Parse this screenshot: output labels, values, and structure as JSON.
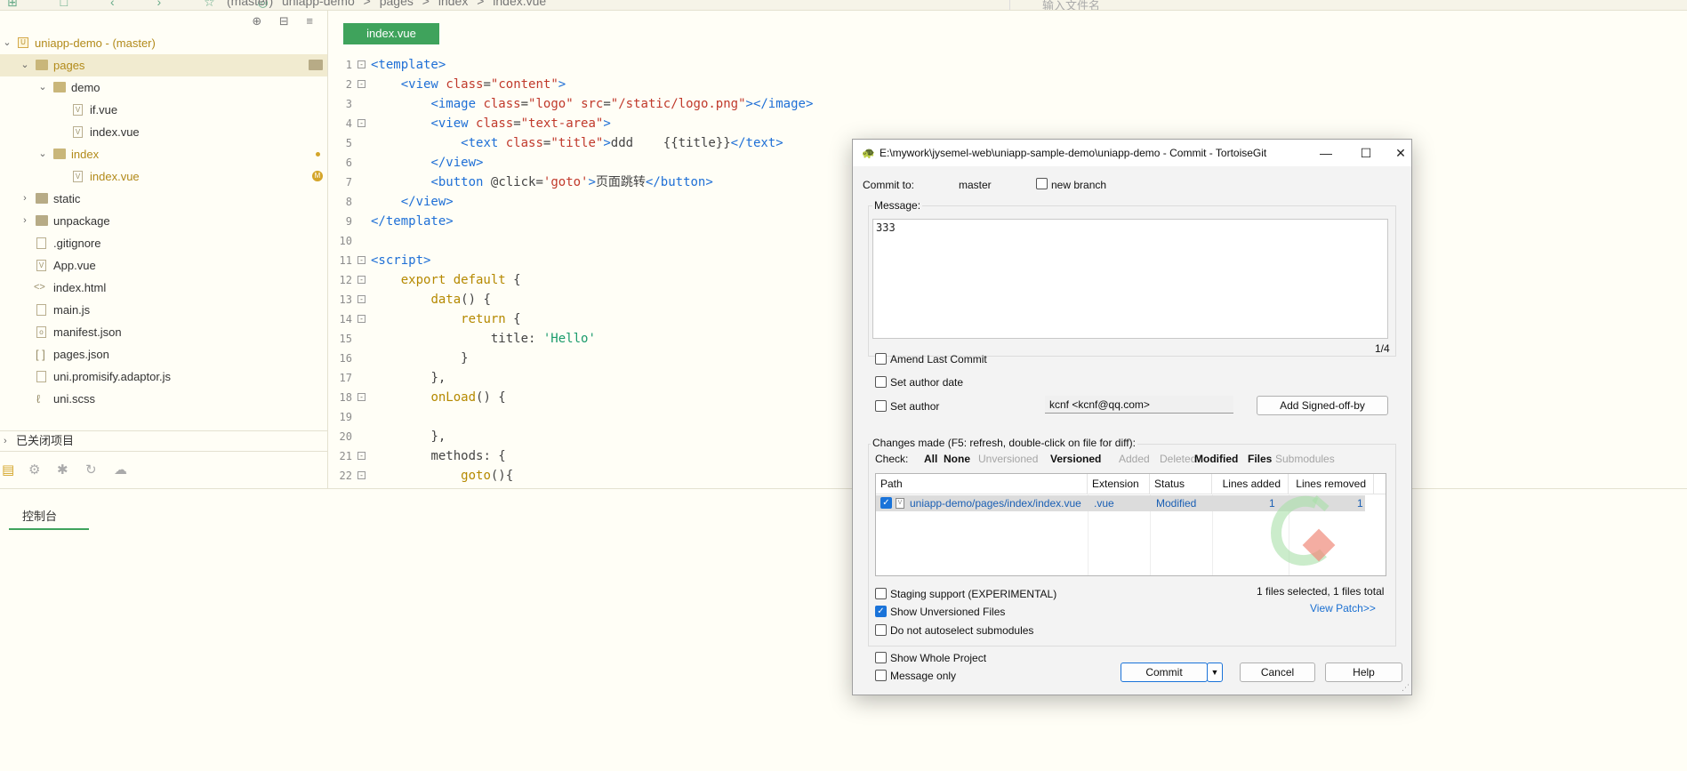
{
  "topbar": {
    "breadcrumbs": [
      "(master)",
      "uniapp-demo",
      ">",
      "pages",
      ">",
      "index",
      ">",
      "index.vue"
    ],
    "search_placeholder": "输入文件名"
  },
  "sidebar": {
    "tree": [
      {
        "label": "uniapp-demo - (master)",
        "kind": "project",
        "arrow": "v"
      },
      {
        "label": "pages",
        "kind": "folder-open",
        "arrow": "v"
      },
      {
        "label": "demo",
        "kind": "folder-open",
        "arrow": "v"
      },
      {
        "label": "if.vue",
        "kind": "file"
      },
      {
        "label": "index.vue",
        "kind": "file"
      },
      {
        "label": "index",
        "kind": "folder-open",
        "arrow": "v"
      },
      {
        "label": "index.vue",
        "kind": "file"
      },
      {
        "label": "static",
        "kind": "folder",
        "arrow": ">"
      },
      {
        "label": "unpackage",
        "kind": "folder",
        "arrow": ">"
      },
      {
        "label": ".gitignore",
        "kind": "file"
      },
      {
        "label": "App.vue",
        "kind": "file"
      },
      {
        "label": "index.html",
        "kind": "file"
      },
      {
        "label": "main.js",
        "kind": "file"
      },
      {
        "label": "manifest.json",
        "kind": "file"
      },
      {
        "label": "pages.json",
        "kind": "file"
      },
      {
        "label": "uni.promisify.adaptor.js",
        "kind": "file"
      },
      {
        "label": "uni.scss",
        "kind": "file"
      }
    ],
    "modified_badge": "M",
    "closed_projects": "已关闭项目"
  },
  "editor": {
    "tab_label": "index.vue",
    "line_numbers": [
      "1",
      "2",
      "3",
      "4",
      "5",
      "6",
      "7",
      "8",
      "9",
      "10",
      "11",
      "12",
      "13",
      "14",
      "15",
      "16",
      "17",
      "18",
      "19",
      "20",
      "21",
      "22"
    ]
  },
  "console": {
    "tab_label": "控制台"
  },
  "dialog": {
    "title": "E:\\mywork\\jysemel-web\\uniapp-sample-demo\\uniapp-demo - Commit - TortoiseGit",
    "commit_to_label": "Commit to:",
    "branch": "master",
    "new_branch_label": "new branch",
    "message_label": "Message:",
    "message_value": "333",
    "message_counter": "1/4",
    "amend_label": "Amend Last Commit",
    "set_author_date_label": "Set author date",
    "set_author_label": "Set author",
    "author_value": "kcnf <kcnf@qq.com>",
    "signed_off_button": "Add Signed-off-by",
    "changes_label": "Changes made (F5: refresh, double-click on file for diff):",
    "check_label": "Check:",
    "filters": [
      "All",
      "None",
      "Unversioned",
      "Versioned",
      "Added",
      "Deleted",
      "Modified",
      "Files",
      "Submodules"
    ],
    "columns": [
      "Path",
      "Extension",
      "Status",
      "Lines added",
      "Lines removed"
    ],
    "files": [
      {
        "path": "uniapp-demo/pages/index/index.vue",
        "extension": ".vue",
        "status": "Modified",
        "lines_added": "1",
        "lines_removed": "1"
      }
    ],
    "selection_summary": "1 files selected, 1 files total",
    "staging_label": "Staging support (EXPERIMENTAL)",
    "show_unversioned_label": "Show Unversioned Files",
    "no_autoselect_label": "Do not autoselect submodules",
    "view_patch_label": "View Patch>>",
    "show_whole_project_label": "Show Whole Project",
    "message_only_label": "Message only",
    "commit_button": "Commit",
    "cancel_button": "Cancel",
    "help_button": "Help"
  },
  "colors": {
    "accent_green": "#3fa35c",
    "link_blue": "#1a6fd1",
    "annotation_red": "#e02020"
  }
}
